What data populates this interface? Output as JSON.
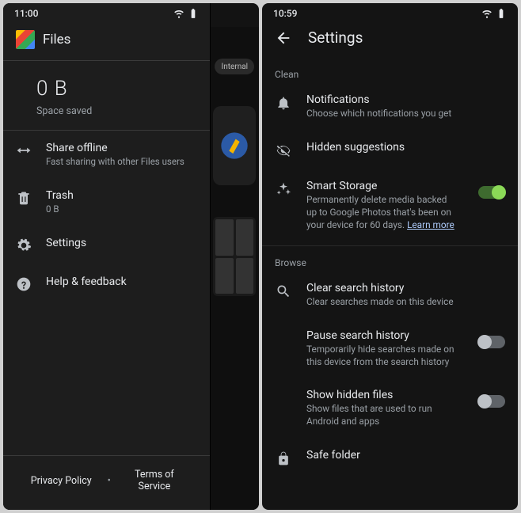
{
  "phone1": {
    "status": {
      "time": "11:00"
    },
    "app_title": "Files",
    "space": {
      "value": "0 B",
      "label": "Space saved"
    },
    "menu": {
      "share": {
        "title": "Share offline",
        "sub": "Fast sharing with other Files users"
      },
      "trash": {
        "title": "Trash",
        "sub": "0 B"
      },
      "settings": {
        "title": "Settings"
      },
      "help": {
        "title": "Help & feedback"
      }
    },
    "footer": {
      "privacy": "Privacy Policy",
      "terms": "Terms of Service"
    },
    "backdrop": {
      "chip": "Internal"
    }
  },
  "phone2": {
    "status": {
      "time": "10:59"
    },
    "title": "Settings",
    "sections": {
      "clean_label": "Clean",
      "browse_label": "Browse"
    },
    "notifications": {
      "title": "Notifications",
      "sub": "Choose which notifications you get"
    },
    "hidden_suggestions": {
      "title": "Hidden suggestions"
    },
    "smart_storage": {
      "title": "Smart Storage",
      "sub": "Permanently delete media backed up to Google Photos that's been on your device for 60 days. ",
      "learn_more": "Learn more",
      "toggle": true
    },
    "clear_search": {
      "title": "Clear search history",
      "sub": "Clear searches made on this device"
    },
    "pause_search": {
      "title": "Pause search history",
      "sub": "Temporarily hide searches made on this device from the search history",
      "toggle": false
    },
    "show_hidden": {
      "title": "Show hidden files",
      "sub": "Show files that are used to run Android and apps",
      "toggle": false
    },
    "safe_folder": {
      "title": "Safe folder"
    }
  }
}
